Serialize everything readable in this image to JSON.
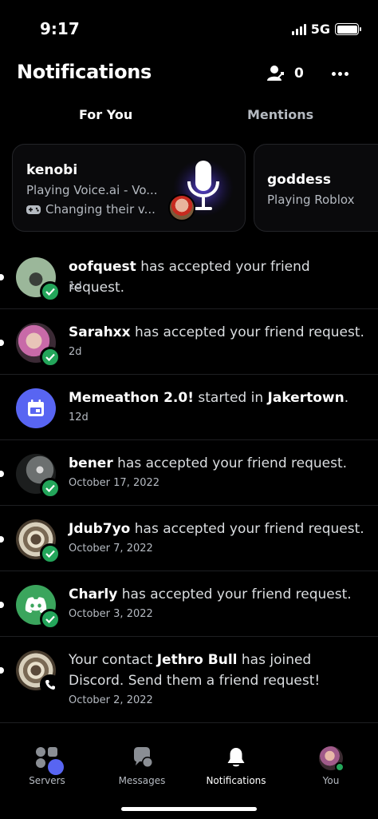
{
  "status": {
    "time": "9:17",
    "network": "5G"
  },
  "header": {
    "title": "Notifications",
    "friend_request_count": "0"
  },
  "tabs": [
    {
      "label": "For You"
    },
    {
      "label": "Mentions"
    }
  ],
  "activity": [
    {
      "name": "kenobi",
      "status": "Playing Voice.ai - Vo...",
      "detail": "Changing their v..."
    },
    {
      "name": "goddess",
      "status": "Playing Roblox"
    }
  ],
  "notifications": [
    {
      "user": "oofquest",
      "text": " has accepted your friend request.",
      "time": "1d"
    },
    {
      "user": "Sarahxx",
      "text": " has accepted your friend request.",
      "time": "2d"
    },
    {
      "user": "Memeathon 2.0!",
      "text": " started in ",
      "place": "Jakertown",
      "suffix": ".",
      "time": "12d"
    },
    {
      "user": "bener",
      "text": " has accepted your friend request.",
      "time": "October 17, 2022"
    },
    {
      "user": "Jdub7yo",
      "text": " has accepted your friend request.",
      "time": "October 7, 2022"
    },
    {
      "user": "Charly",
      "text": " has accepted your friend request.",
      "time": "October 3, 2022"
    },
    {
      "prefix": "Your contact ",
      "user": "Jethro Bull",
      "text": " has joined Discord. Send them a friend request!",
      "time": "October 2, 2022"
    }
  ],
  "nav": [
    {
      "label": "Servers",
      "icon": "servers-icon"
    },
    {
      "label": "Messages",
      "icon": "messages-icon"
    },
    {
      "label": "Notifications",
      "icon": "bell-icon"
    },
    {
      "label": "You",
      "icon": "avatar"
    }
  ],
  "colors": {
    "accent": "#5865f2",
    "success": "#23a55a",
    "background": "#000000"
  }
}
